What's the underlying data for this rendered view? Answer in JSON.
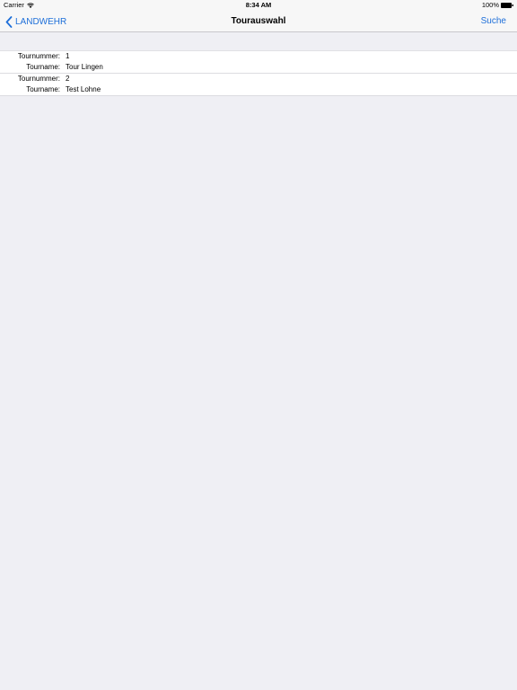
{
  "status_bar": {
    "carrier": "Carrier",
    "time": "8:34 AM",
    "battery": "100%"
  },
  "nav_bar": {
    "back_label": "LANDWEHR",
    "title": "Tourauswahl",
    "search_label": "Suche"
  },
  "tours": [
    {
      "number_label": "Tournummer:",
      "number": "1",
      "name_label": "Tourname:",
      "name": "Tour Lingen"
    },
    {
      "number_label": "Tournummer:",
      "number": "2",
      "name_label": "Tourname:",
      "name": "Test Lohne"
    }
  ],
  "colors": {
    "accent": "#1e6fd9",
    "background": "#efeff4",
    "bar": "#f7f7f7"
  }
}
